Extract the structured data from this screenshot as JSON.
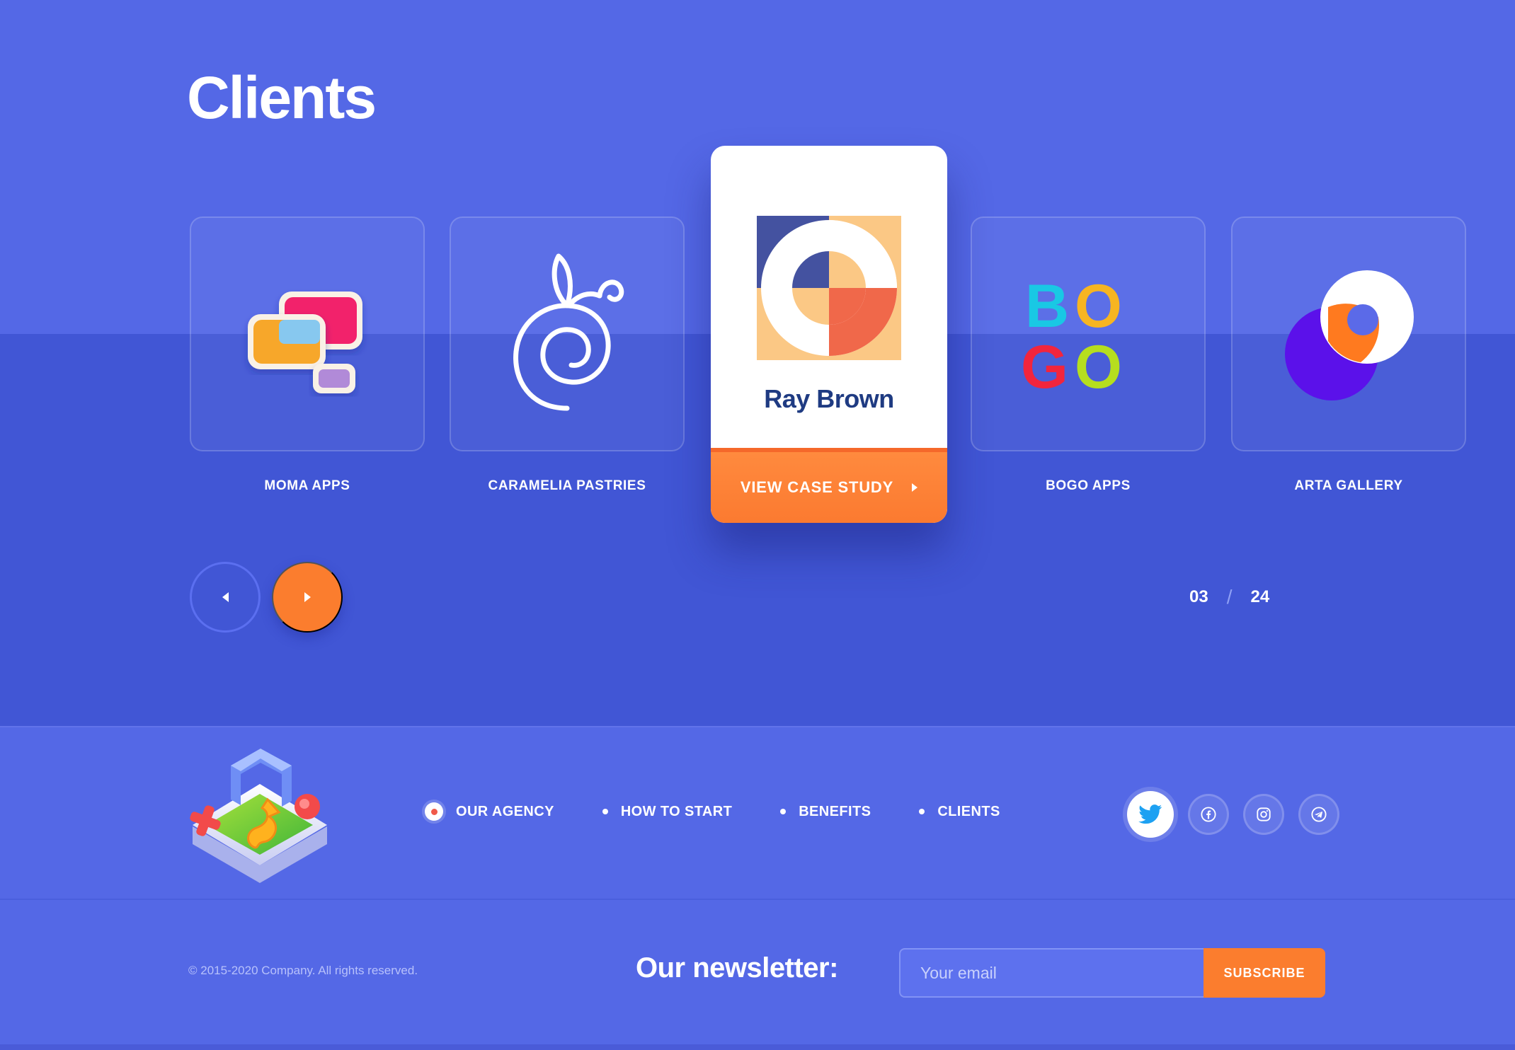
{
  "page": {
    "title": "Clients"
  },
  "clients": [
    {
      "label": "MOMA APPS",
      "icon": "moma-apps-logo"
    },
    {
      "label": "CARAMELIA PASTRIES",
      "icon": "caramelia-logo"
    },
    {
      "label": "BOGO APPS",
      "icon": "bogo-apps-logo",
      "logo_text": "BOGO"
    },
    {
      "label": "ARTA GALLERY",
      "icon": "arta-gallery-logo"
    }
  ],
  "featured": {
    "name": "Ray Brown",
    "cta": "VIEW CASE STUDY",
    "icon": "ray-brown-logo"
  },
  "pager": {
    "current": "03",
    "separator": "/",
    "total": "24"
  },
  "footer": {
    "menu": [
      {
        "label": "OUR AGENCY",
        "active": true
      },
      {
        "label": "HOW TO START",
        "active": false
      },
      {
        "label": "BENEFITS",
        "active": false
      },
      {
        "label": "CLIENTS",
        "active": false
      }
    ],
    "socials": [
      "twitter-icon",
      "facebook-icon",
      "instagram-icon",
      "telegram-icon"
    ],
    "copyright": "© 2015-2020 Company. All rights reserved.",
    "newsletter": {
      "label": "Our newsletter:",
      "placeholder": "Your email",
      "button": "SUBSCRIBE"
    }
  },
  "colors": {
    "background": "#5468e6",
    "band": "#4156d5",
    "accent": "#fb7d2e",
    "brand_dark": "#1f3b82"
  }
}
